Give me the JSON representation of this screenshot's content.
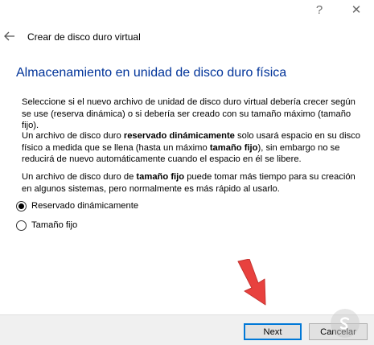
{
  "window": {
    "help_glyph": "?",
    "close_glyph": "✕"
  },
  "wizard": {
    "title": "Crear de disco duro virtual",
    "heading": "Almacenamiento en unidad de disco duro física",
    "paragraph1": "Seleccione si el nuevo archivo de unidad de disco duro virtual debería crecer según se use (reserva dinámica) o si debería ser creado con su tamaño máximo (tamaño fijo).",
    "paragraph2": {
      "part1": "Un archivo de disco duro ",
      "bold1": "reservado dinámicamente",
      "part2": " solo usará espacio en su disco físico a medida que se llena (hasta un máximo ",
      "bold2": "tamaño fijo",
      "part3": "), sin embargo no se reducirá de nuevo automáticamente cuando el espacio en él se libere."
    },
    "paragraph3": {
      "part1": "Un archivo de disco duro de ",
      "bold1": "tamaño fijo",
      "part2": " puede tomar más tiempo para su creación en algunos sistemas, pero normalmente es más rápido al usarlo."
    },
    "options": [
      {
        "label": "Reservado dinámicamente",
        "selected": true
      },
      {
        "label": "Tamaño fijo",
        "selected": false
      }
    ]
  },
  "buttons": {
    "next": "Next",
    "cancel": "Cancelar"
  },
  "colors": {
    "heading": "#003399",
    "focus_border": "#0078d7",
    "arrow": "#e8413e"
  },
  "icons": {
    "back": "back-arrow-icon",
    "pointer": "red-arrow-icon",
    "watermark": "watermark-logo-icon"
  }
}
